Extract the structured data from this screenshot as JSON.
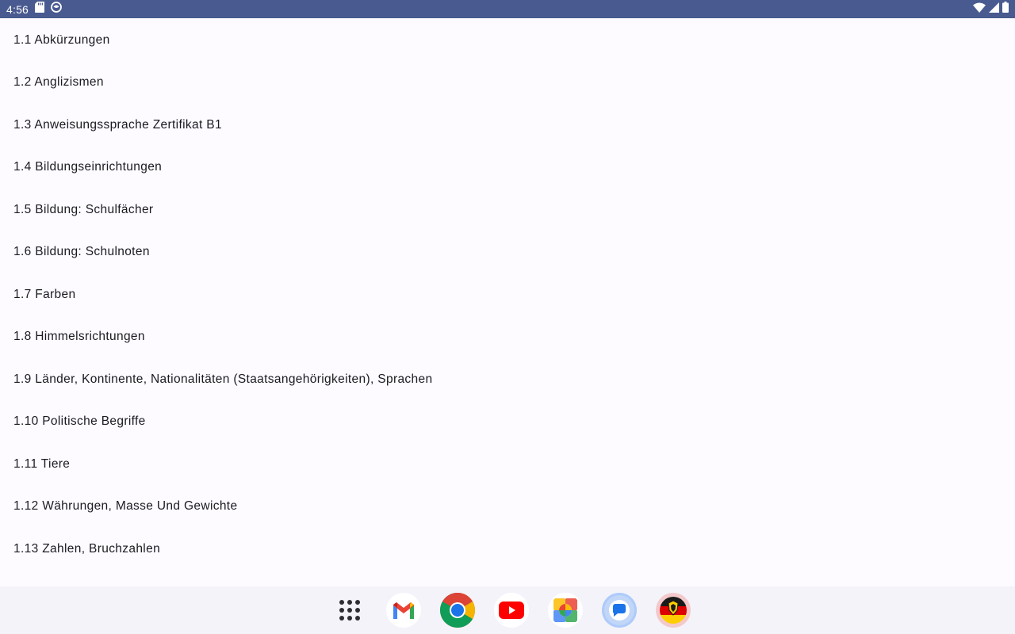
{
  "status_bar": {
    "time": "4:56",
    "left_icons": [
      "sd-card-icon",
      "app-notification-icon"
    ],
    "right_icons": [
      "wifi-icon",
      "cellular-signal-icon",
      "battery-icon"
    ],
    "color": "#485A8F"
  },
  "list": {
    "items": [
      {
        "label": "1.1 Abkürzungen"
      },
      {
        "label": "1.2 Anglizismen"
      },
      {
        "label": "1.3 Anweisungssprache Zertifikat B1"
      },
      {
        "label": "1.4 Bildungseinrichtungen"
      },
      {
        "label": "1.5 Bildung: Schulfächer"
      },
      {
        "label": "1.6 Bildung: Schulnoten"
      },
      {
        "label": "1.7 Farben"
      },
      {
        "label": "1.8 Himmelsrichtungen"
      },
      {
        "label": "1.9 Länder, Kontinente, Nationalitäten (Staatsangehörigkeiten), Sprachen"
      },
      {
        "label": "1.10 Politische Begriffe"
      },
      {
        "label": "1.11 Tiere"
      },
      {
        "label": "1.12 Währungen, Masse Und Gewichte"
      },
      {
        "label": "1.13 Zahlen, Bruchzahlen"
      }
    ]
  },
  "taskbar": {
    "apps": [
      {
        "name": "app-drawer-icon"
      },
      {
        "name": "gmail-icon"
      },
      {
        "name": "chrome-icon"
      },
      {
        "name": "youtube-icon"
      },
      {
        "name": "photos-icon"
      },
      {
        "name": "messages-icon"
      },
      {
        "name": "german-flag-app-icon"
      }
    ]
  }
}
